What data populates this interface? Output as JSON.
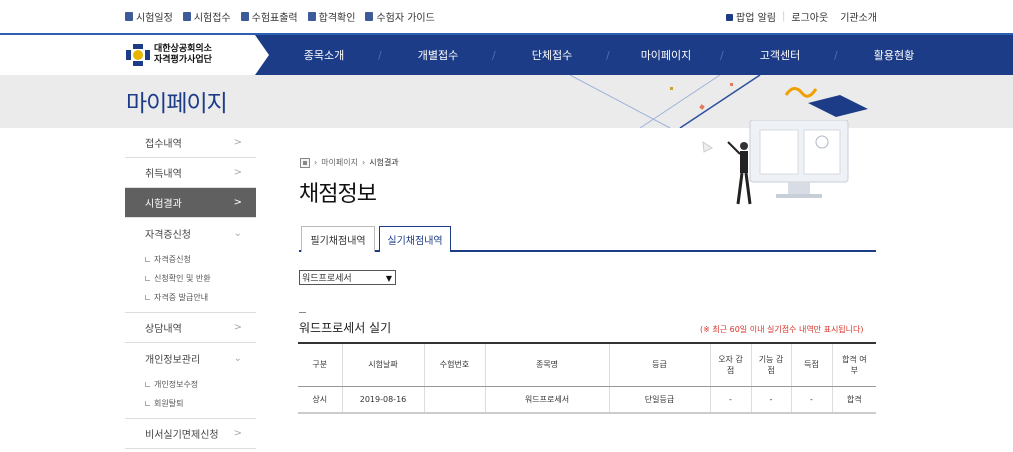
{
  "util": {
    "left": [
      "시험일정",
      "시험접수",
      "수험표출력",
      "합격확인",
      "수험자 가이드"
    ],
    "right": [
      "팝업 알림",
      "로그아웃",
      "기관소개"
    ]
  },
  "logo": {
    "line1": "대한상공회의소",
    "line2": "자격평가사업단"
  },
  "gnb": [
    "종목소개",
    "개별접수",
    "단체접수",
    "마이페이지",
    "고객센터",
    "활용현황"
  ],
  "banner": {
    "title": "마이페이지"
  },
  "sidebar": {
    "items": [
      {
        "label": "접수내역"
      },
      {
        "label": "취득내역"
      },
      {
        "label": "시험결과"
      },
      {
        "label": "자격증신청",
        "sub": [
          "자격증신청",
          "신청확인 및 반환",
          "자격증 발급안내"
        ]
      },
      {
        "label": "상담내역"
      },
      {
        "label": "개인정보관리",
        "sub": [
          "개인정보수정",
          "회원탈퇴"
        ]
      },
      {
        "label": "비서실기면제신청"
      }
    ]
  },
  "breadcrumb": [
    "마이페이지",
    "시험결과"
  ],
  "page": {
    "title": "채점정보"
  },
  "tabs": [
    "필기채점내역",
    "실기채점내역"
  ],
  "select": {
    "value": "워드프로세서"
  },
  "section": {
    "title": "워드프로세서 실기",
    "note": "(※ 최근 60일 이내 실기점수 내역만 표시됩니다)"
  },
  "table": {
    "headers": [
      "구분",
      "시험날짜",
      "수험번호",
      "종목명",
      "등급",
      "오자 감점",
      "기능 감점",
      "득점",
      "합격 여부"
    ],
    "rows": [
      [
        "상시",
        "2019-08-16",
        "",
        "워드프로세서",
        "단일등급",
        "-",
        "-",
        "-",
        "합격"
      ]
    ]
  },
  "colors": {
    "navy": "#1d3c87",
    "note_red": "#d8332a",
    "active_menu": "#606060"
  }
}
